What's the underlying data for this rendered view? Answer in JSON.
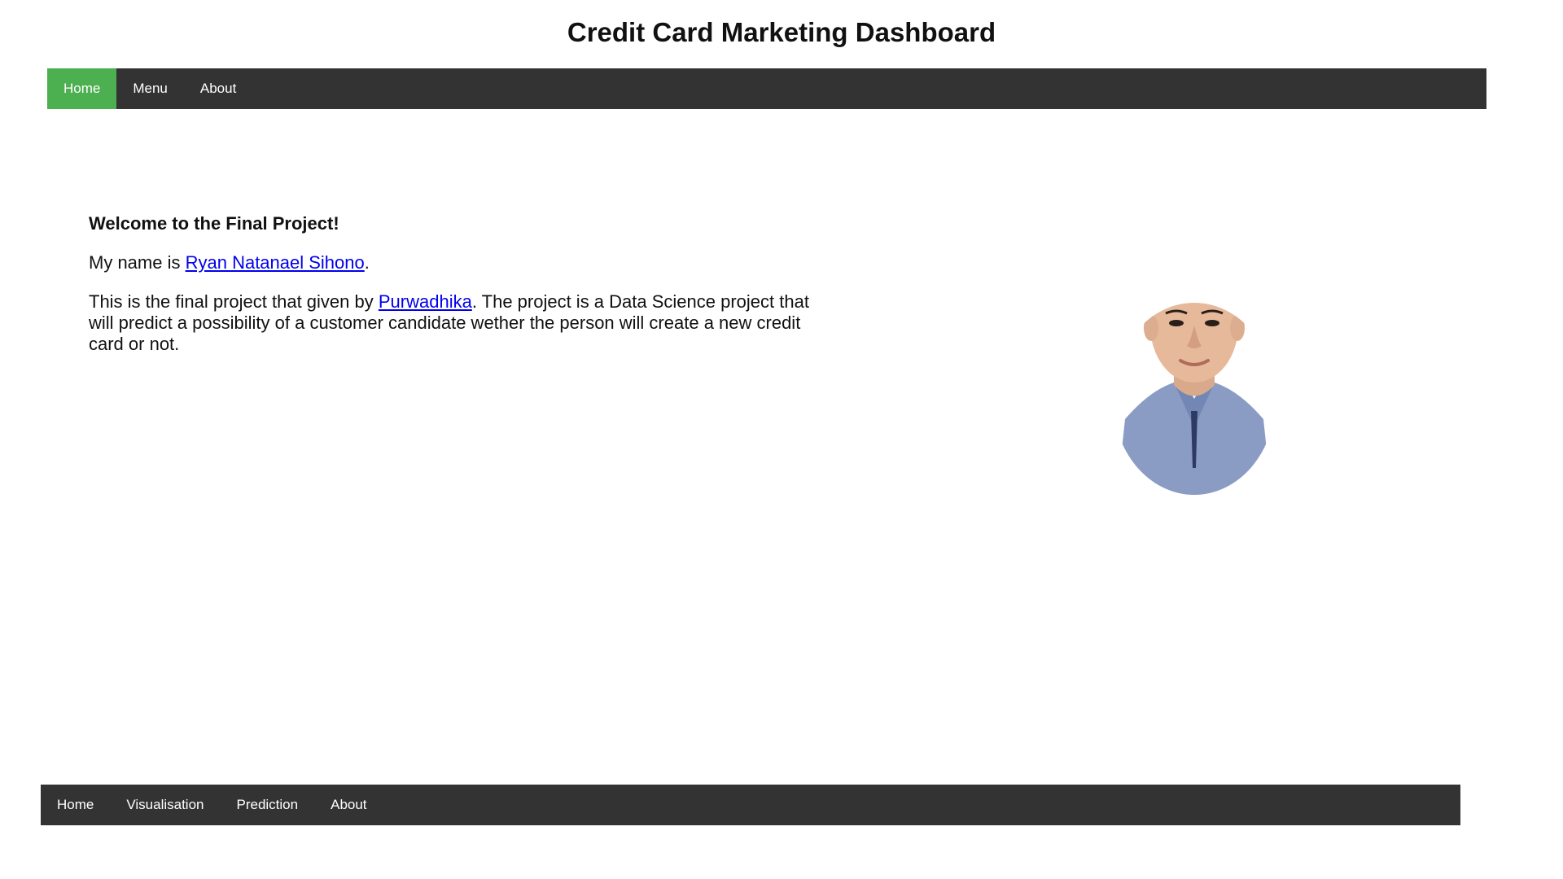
{
  "header": {
    "title": "Credit Card Marketing Dashboard"
  },
  "topnav": {
    "items": [
      {
        "label": "Home",
        "active": true
      },
      {
        "label": "Menu",
        "active": false
      },
      {
        "label": "About",
        "active": false
      }
    ],
    "active_color": "#4caf50",
    "bg_color": "#333333"
  },
  "main": {
    "welcome": "Welcome to the Final Project!",
    "name_prefix": "My name is ",
    "name_link": "Ryan Natanael Sihono",
    "name_suffix": ".",
    "project_prefix": "This is the final project that given by ",
    "project_link": "Purwadhika",
    "project_suffix": ". The project is a Data Science project that will predict a possibility of a customer candidate wether the person will create a new credit card or not.",
    "link_color": "#0000ee"
  },
  "portrait": {
    "icon": "person-portrait"
  },
  "footer_nav": {
    "items": [
      {
        "label": "Home"
      },
      {
        "label": "Visualisation"
      },
      {
        "label": "Prediction"
      },
      {
        "label": "About"
      }
    ],
    "bg_color": "#333333"
  }
}
